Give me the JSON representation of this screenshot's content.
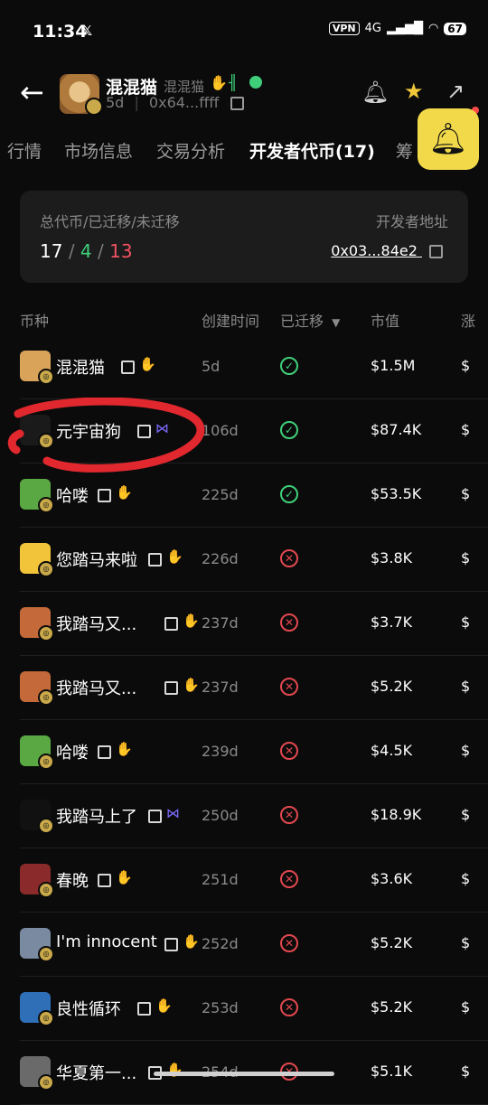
{
  "status_bar": {
    "time": "11:34",
    "x_label": "𝕏",
    "vpn": "VPN",
    "network": "4G",
    "battery": "67"
  },
  "header": {
    "back_icon": "←",
    "token_name": "混混猫",
    "token_symbol": "混混猫",
    "age": "5d",
    "address": "0x64...ffff",
    "icons": [
      "alert-bell-plus-icon",
      "star-icon",
      "share-icon"
    ]
  },
  "tabs": [
    "行情",
    "市场信息",
    "交易分析",
    "开发者代币(17)",
    "筹"
  ],
  "summary": {
    "label": "总代币/已迁移/未迁移",
    "dev_label": "开发者地址",
    "total": "17",
    "slash": "/",
    "migrated": "4",
    "unmigrated": "13",
    "dev_address": "0x03...84e2"
  },
  "columns": {
    "coin": "币种",
    "created": "创建时间",
    "migrated": "已迁移",
    "mcap": "市值",
    "more": "涨"
  },
  "rows": [
    {
      "name": "混混猫",
      "tag": "hand",
      "age": "5d",
      "migrated": true,
      "mcap": "$1.5M",
      "more": "$"
    },
    {
      "name": "元宇宙狗",
      "tag": "fly",
      "age": "106d",
      "migrated": true,
      "mcap": "$87.4K",
      "more": "$"
    },
    {
      "name": "哈喽",
      "tag": "hand",
      "age": "225d",
      "migrated": true,
      "mcap": "$53.5K",
      "more": "$"
    },
    {
      "name": "您踏马来啦",
      "tag": "hand",
      "age": "226d",
      "migrated": false,
      "mcap": "$3.8K",
      "more": "$"
    },
    {
      "name": "我踏马又...",
      "tag": "hand",
      "age": "237d",
      "migrated": false,
      "mcap": "$3.7K",
      "more": "$"
    },
    {
      "name": "我踏马又...",
      "tag": "hand",
      "age": "237d",
      "migrated": false,
      "mcap": "$5.2K",
      "more": "$"
    },
    {
      "name": "哈喽",
      "tag": "hand",
      "age": "239d",
      "migrated": false,
      "mcap": "$4.5K",
      "more": "$"
    },
    {
      "name": "我踏马上了",
      "tag": "fly",
      "age": "250d",
      "migrated": false,
      "mcap": "$18.9K",
      "more": "$"
    },
    {
      "name": "春晚",
      "tag": "hand",
      "age": "251d",
      "migrated": false,
      "mcap": "$3.6K",
      "more": "$"
    },
    {
      "name": "I'm innocent",
      "tag": "hand",
      "age": "252d",
      "migrated": false,
      "mcap": "$5.2K",
      "more": "$"
    },
    {
      "name": "良性循环",
      "tag": "hand",
      "age": "253d",
      "migrated": false,
      "mcap": "$5.2K",
      "more": "$"
    },
    {
      "name": "华夏第一...",
      "tag": "hand",
      "age": "254d",
      "migrated": false,
      "mcap": "$5.1K",
      "more": "$"
    }
  ],
  "colors": {
    "accent_yellow": "#f2d94a",
    "green": "#3fcf7a",
    "red": "#e2484f",
    "annotation_red": "#e0282e"
  }
}
